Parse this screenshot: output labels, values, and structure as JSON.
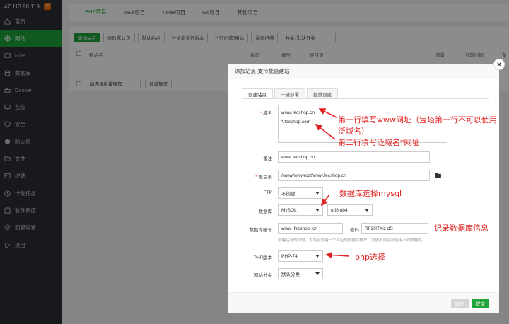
{
  "sidebar": {
    "ip": "47.113.98.119",
    "badge": "0",
    "items": [
      {
        "label": "首页",
        "icon": "home-icon"
      },
      {
        "label": "网站",
        "icon": "globe-icon",
        "active": true
      },
      {
        "label": "FTP",
        "icon": "ftp-icon"
      },
      {
        "label": "数据库",
        "icon": "database-icon"
      },
      {
        "label": "Docker",
        "icon": "docker-icon"
      },
      {
        "label": "监控",
        "icon": "monitor-icon"
      },
      {
        "label": "安全",
        "icon": "shield-icon"
      },
      {
        "label": "防火墙",
        "icon": "firewall-icon"
      },
      {
        "label": "文件",
        "icon": "folder-icon"
      },
      {
        "label": "终端",
        "icon": "terminal-icon"
      },
      {
        "label": "计划任务",
        "icon": "clock-icon"
      },
      {
        "label": "软件商店",
        "icon": "store-icon"
      },
      {
        "label": "面板设置",
        "icon": "gear-icon"
      },
      {
        "label": "退出",
        "icon": "logout-icon"
      }
    ]
  },
  "main": {
    "tabs": [
      "PHP项目",
      "Java项目",
      "Node项目",
      "Go项目",
      "其他项目"
    ],
    "toolbar": {
      "buttons": [
        "添加站点",
        "修改默认页",
        "默认站点",
        "PHP命令行版本",
        "HTTPS防窜站",
        "漏洞扫描"
      ],
      "category_select": "分类: 默认分类"
    },
    "table_headers": [
      "网站名",
      "状态",
      "备份",
      "根目录",
      "流量",
      "到期时间",
      "备"
    ],
    "batch": {
      "select_placeholder": "请选择批量操作",
      "run_label": "批量操作"
    }
  },
  "modal": {
    "title": "添加站点-支持批量建站",
    "tabs": [
      "创建站点",
      "一键部署",
      "批量创建"
    ],
    "domain": {
      "label": "域名",
      "lines": [
        "www.fecshop.cn",
        "*.fecshop.com"
      ]
    },
    "remark": {
      "label": "备注",
      "value": "www.fecshop.cn"
    },
    "root": {
      "label": "根目录",
      "value": "/www/wwwroot/www.fecshop.cn"
    },
    "ftp": {
      "label": "FTP",
      "value": "不创建"
    },
    "db": {
      "label": "数据库",
      "type": "MySQL",
      "charset": "utf8mb4"
    },
    "db_account": {
      "label": "数据库账号",
      "user": "www_fecshop_cn",
      "pass_label": "密码",
      "pass": "RF2HTXiz        dS"
    },
    "db_hint": "创建站点的同时，为站点创建一个对应的数据库帐户，方便不同站点使用不同数据库。",
    "php": {
      "label": "PHP版本",
      "value": "PHP-74"
    },
    "category": {
      "label": "网站分类",
      "value": "默认分类"
    },
    "footer": {
      "cancel": "取消",
      "submit": "提交"
    }
  },
  "annotations": {
    "domain_line1": "第一行填写www网址（宝塔第一行不可以使用",
    "domain_line1b": "泛域名）",
    "domain_line2": "第二行填写泛域名*网址",
    "db_note": "数据库选择mysql",
    "db_info": "记录数据库信息",
    "php_note": "php选择"
  },
  "colors": {
    "accent": "#20a53a",
    "annotation": "#e02020",
    "sidebar": "#2c2f33"
  }
}
